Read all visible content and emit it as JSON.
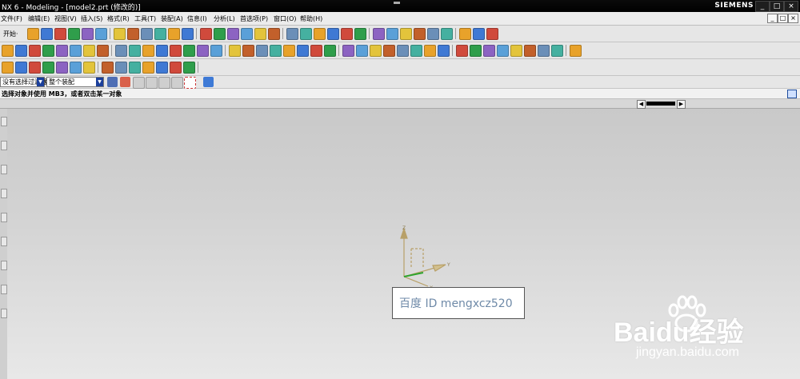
{
  "window": {
    "title": "NX 6 - Modeling - [model2.prt (修改的)]",
    "brand": "SIEMENS",
    "controls": [
      "_",
      "□",
      "×"
    ]
  },
  "menu": {
    "items": [
      "文件(F)",
      "编辑(E)",
      "视图(V)",
      "插入(S)",
      "格式(R)",
      "工具(T)",
      "装配(A)",
      "信息(I)",
      "分析(L)",
      "首选项(P)",
      "窗口(O)",
      "帮助(H)"
    ],
    "mdi_controls": [
      "_",
      "□",
      "×"
    ]
  },
  "toolbar1": {
    "start_label": "开始·"
  },
  "filterbar": {
    "type_filter": "没有选择过滤器",
    "scope_filter": "整个装配"
  },
  "status": {
    "message": "选择对象并使用 MB3，或者双击某一对象"
  },
  "graphics": {
    "triad_labels": [
      "Z",
      "Y",
      "X"
    ]
  },
  "watermark": {
    "id_text": "百度 ID mengxcz520",
    "baidu_text": "Baidu经验",
    "baidu_url": "jingyan.baidu.com"
  },
  "colors": {
    "title_bg": "#000000",
    "toolbar_bg": "#e6e6e6",
    "viewport_top": "#c9c9c9",
    "viewport_bottom": "#e8e8e8",
    "triad": "#b8a068"
  },
  "icons": {
    "toolbar1": [
      "start-icon",
      "new-icon",
      "open-icon",
      "save-icon",
      "cut-icon",
      "copy-icon",
      "paste-icon",
      "undo-icon",
      "redo-icon",
      "select-icon",
      "wrench-icon",
      "fit-icon",
      "zoom-icon",
      "zoom-window-icon",
      "pan-icon",
      "rotate-icon",
      "perspective-icon",
      "shade-icon",
      "view-orient-icon",
      "render-style-icon",
      "background-icon",
      "section-icon",
      "wcs-icon",
      "csys-icon",
      "datum-icon",
      "point-icon",
      "snap-icon",
      "measure-icon",
      "ruler-icon",
      "part-nav-icon",
      "assembly-icon",
      "layer-icon",
      "display-icon"
    ],
    "toolbar2": [
      "sketch-icon",
      "extrude-icon",
      "revolve-icon",
      "hole-icon",
      "boss-icon",
      "pocket-icon",
      "pad-icon",
      "line-icon",
      "arc-icon",
      "block-icon",
      "cylinder-icon",
      "cone-icon",
      "sphere-icon",
      "union-icon",
      "subtract-icon",
      "intersect-icon",
      "edge-blend-icon",
      "chamfer-icon",
      "shell-icon",
      "draft-icon",
      "pattern-icon",
      "mirror-icon",
      "trim-body-icon",
      "split-body-icon",
      "offset-face-icon",
      "scale-icon",
      "thicken-icon",
      "sew-icon",
      "patch-icon",
      "wrap-icon",
      "emboss-icon",
      "sweep-icon",
      "tube-icon",
      "rib-icon",
      "groove-icon",
      "slot-icon",
      "thread-icon",
      "unite-face-icon",
      "delete-face-icon",
      "replace-face-icon",
      "move-face-icon"
    ],
    "toolbar3": [
      "curve-icon",
      "spline-icon",
      "helix-icon",
      "offset-curve-icon",
      "project-curve-icon",
      "bridge-curve-icon",
      "surface-icon",
      "through-curves-icon",
      "mesh-icon",
      "swept-surface-icon",
      "ruled-icon",
      "n-sided-icon",
      "extension-icon",
      "law-icon"
    ]
  }
}
